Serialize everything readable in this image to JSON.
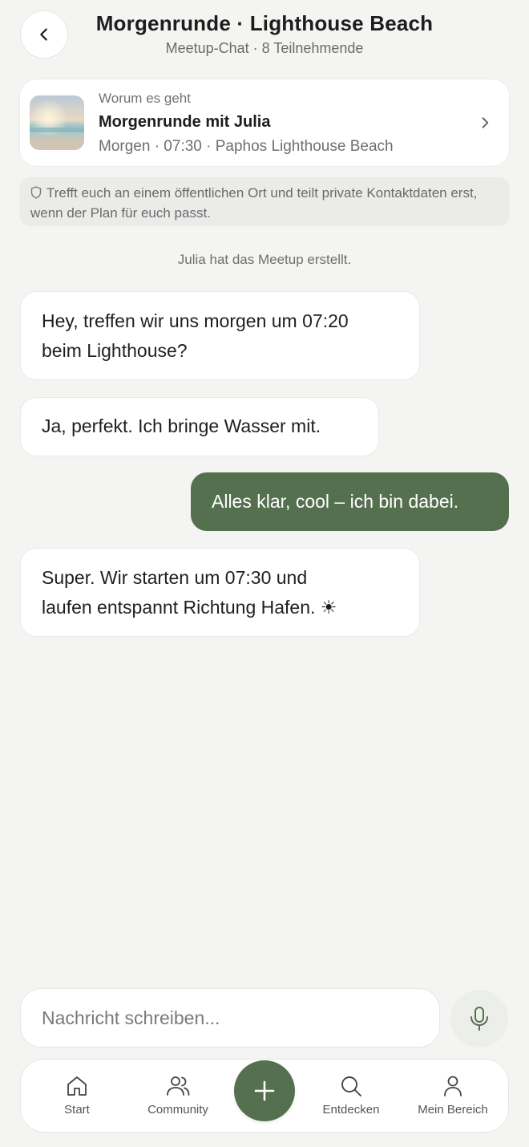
{
  "header": {
    "title": "Morgenrunde · Lighthouse Beach",
    "subtitle": "Meetup-Chat · 8 Teilnehmende"
  },
  "topic_card": {
    "kicker": "Worum es geht",
    "title": "Morgenrunde mit Julia",
    "meta": "Morgen · 07:30 · Paphos Lighthouse Beach"
  },
  "safety_note": "Trefft euch an einem öffentlichen Ort und teilt private Kontaktdaten erst, wenn der Plan für euch passt.",
  "system_message": "Julia hat das Meetup erstellt.",
  "messages": [
    {
      "direction": "incoming",
      "lines": [
        "Hey, treffen wir uns morgen um 07:20",
        "beim Lighthouse?"
      ]
    },
    {
      "direction": "incoming",
      "lines": [
        "Ja, perfekt. Ich bringe Wasser mit."
      ]
    },
    {
      "direction": "outgoing",
      "lines": [
        "Alles klar, cool – ich bin dabei."
      ]
    },
    {
      "direction": "incoming",
      "lines": [
        "Super. Wir starten um 07:30 und",
        "laufen entspannt Richtung Hafen. ☀"
      ]
    }
  ],
  "composer": {
    "placeholder": "Nachricht schreiben..."
  },
  "nav": {
    "items": [
      {
        "label": "Start",
        "icon": "home-icon"
      },
      {
        "label": "Community",
        "icon": "people-icon"
      },
      {
        "label": "Entdecken",
        "icon": "search-icon"
      },
      {
        "label": "Mein Bereich",
        "icon": "person-icon"
      }
    ],
    "fab_icon": "plus-icon"
  },
  "colors": {
    "accent": "#55704f",
    "background": "#f4f4f2",
    "surface": "#ffffff"
  }
}
